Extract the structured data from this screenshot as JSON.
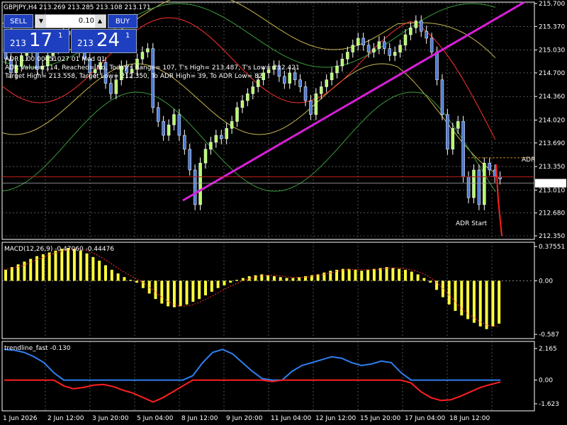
{
  "header": {
    "symbol_line": "GBPJPY,H4  213.269 213.285 213.108 213.171"
  },
  "trade_panel": {
    "sell_label": "SELL",
    "buy_label": "BUY",
    "lot": "0.10",
    "bid_small": "213",
    "bid_big": "17",
    "bid_sup": "1",
    "ask_small": "213",
    "ask_big": "24",
    "ask_sup": "1"
  },
  "adr_info": [
    "ADR 1.00 00051027 01 Mod 01",
    "ADR Value= 114, Reached= No, Today's Range= 107, T's High= 213.487, T's Low= 212.421",
    "Target High= 213.558, Target Low= 212.350, To ADR High= 39, To ADR Low= 82"
  ],
  "labels": {
    "adr": "ADR",
    "adr_start": "ADR Start",
    "current_price": "213.171"
  },
  "macd_title": "MACD(12,26,9) -0.47060 -0.44476",
  "trend_title": "trendline_fast -0.130",
  "price_axis": [
    "215.700",
    "215.370",
    "215.030",
    "214.700",
    "214.360",
    "214.020",
    "213.690",
    "213.350",
    "213.010",
    "212.680",
    "212.350"
  ],
  "macd_axis": [
    "0.37551",
    "0.00",
    "-0.587"
  ],
  "trend_axis": [
    "2.165",
    "0.00",
    "-1.623"
  ],
  "time_axis": [
    "1 Jun 2026",
    "2 Jun 12:00",
    "3 Jun 20:00",
    "5 Jun 04:00",
    "8 Jun 12:00",
    "9 Jun 20:00",
    "11 Jun 04:00",
    "12 Jun 12:00",
    "15 Jun 20:00",
    "17 Jun 04:00",
    "18 Jun 12:00"
  ],
  "colors": {
    "bull": "#b6ff6b",
    "bear": "#4f7bd6",
    "trendline": "#d81fd8",
    "macd": "#ffff3a",
    "blue": "#2f7ff0",
    "red": "#ff2020"
  },
  "chart_data": [
    {
      "type": "candlestick",
      "symbol": "GBPJPY",
      "timeframe": "H4",
      "ylim": [
        212.35,
        215.7
      ],
      "closes": [
        214.9,
        214.7,
        214.8,
        214.95,
        215.1,
        215.0,
        214.75,
        214.8,
        214.95,
        215.05,
        215.2,
        215.3,
        215.25,
        215.1,
        215.0,
        214.9,
        214.7,
        214.75,
        214.85,
        214.55,
        214.4,
        214.6,
        214.8,
        214.7,
        214.75,
        214.9,
        215.0,
        215.05,
        214.2,
        214.0,
        213.8,
        213.95,
        214.1,
        213.8,
        213.6,
        213.3,
        212.8,
        213.4,
        213.6,
        213.7,
        213.8,
        213.75,
        213.9,
        214.0,
        214.2,
        214.3,
        214.4,
        214.5,
        214.6,
        214.7,
        214.75,
        214.8,
        214.65,
        214.55,
        214.7,
        214.6,
        214.5,
        214.3,
        214.1,
        214.4,
        214.5,
        214.6,
        214.7,
        214.8,
        214.9,
        215.0,
        215.1,
        215.2,
        215.1,
        215.0,
        215.05,
        215.15,
        215.05,
        214.95,
        215.0,
        215.1,
        215.25,
        215.35,
        215.45,
        215.3,
        215.2,
        215.0,
        214.6,
        214.1,
        213.6,
        213.9,
        214.0,
        213.2,
        212.9,
        213.3,
        212.8,
        213.4,
        213.3,
        213.2,
        213.171
      ],
      "adr_target_high": 213.558,
      "adr_target_low": 212.35,
      "current_price": 213.171
    },
    {
      "type": "bar",
      "title": "MACD(12,26,9) -0.47060 -0.44476",
      "ylim": [
        -0.587,
        0.37551
      ],
      "values": [
        0.12,
        0.15,
        0.18,
        0.21,
        0.24,
        0.27,
        0.29,
        0.31,
        0.33,
        0.35,
        0.36,
        0.35,
        0.33,
        0.3,
        0.26,
        0.22,
        0.17,
        0.12,
        0.08,
        0.04,
        0.01,
        -0.02,
        -0.08,
        -0.14,
        -0.2,
        -0.25,
        -0.28,
        -0.29,
        -0.28,
        -0.26,
        -0.23,
        -0.2,
        -0.16,
        -0.12,
        -0.08,
        -0.05,
        -0.02,
        0.01,
        0.03,
        0.05,
        0.06,
        0.07,
        0.06,
        0.05,
        0.04,
        0.03,
        0.03,
        0.04,
        0.05,
        0.06,
        0.07,
        0.09,
        0.11,
        0.12,
        0.13,
        0.13,
        0.12,
        0.11,
        0.12,
        0.13,
        0.14,
        0.15,
        0.14,
        0.13,
        0.12,
        0.1,
        0.07,
        0.03,
        -0.02,
        -0.1,
        -0.18,
        -0.26,
        -0.33,
        -0.38,
        -0.42,
        -0.46,
        -0.5,
        -0.53,
        -0.5,
        -0.47
      ]
    },
    {
      "type": "line",
      "title": "trendline_fast -0.130",
      "ylim": [
        -1.623,
        2.165
      ],
      "values": [
        2.1,
        2.05,
        1.9,
        1.6,
        1.2,
        0.5,
        -0.4,
        -0.6,
        -0.5,
        -0.35,
        -0.3,
        -0.45,
        -0.7,
        -0.9,
        -1.2,
        -1.5,
        -1.2,
        -0.8,
        -0.4,
        0.3,
        1.2,
        1.9,
        2.1,
        1.8,
        1.2,
        0.6,
        0.1,
        -0.1,
        0.0,
        0.6,
        1.0,
        1.2,
        1.4,
        1.6,
        1.5,
        1.2,
        1.0,
        1.1,
        1.3,
        1.2,
        0.5,
        -0.2,
        -0.8,
        -1.2,
        -1.4,
        -1.35,
        -1.1,
        -0.8,
        -0.5,
        -0.3,
        -0.13
      ]
    }
  ]
}
